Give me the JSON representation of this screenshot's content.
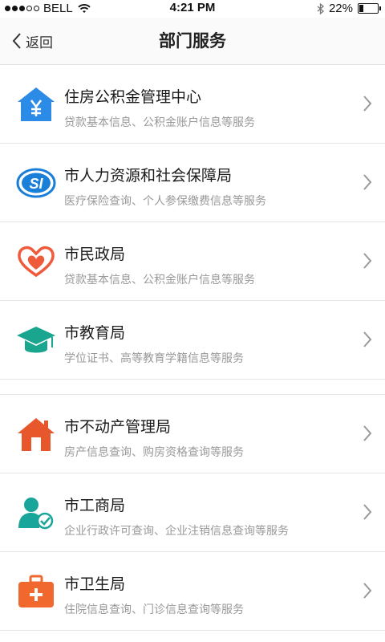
{
  "status": {
    "carrier": "BELL",
    "time": "4:21 PM",
    "battery": "22%",
    "battery_level": 0.22,
    "signal_bars": 3
  },
  "nav": {
    "back_label": "返回",
    "title": "部门服务"
  },
  "services": [
    {
      "name": "住房公积金管理中心",
      "desc": "贷款基本信息、公积金账户信息等服务",
      "icon": "housing-fund-icon",
      "color": "#2b8be6"
    },
    {
      "name": "市人力资源和社会保障局",
      "desc": "医疗保险查询、个人参保缴费信息等服务",
      "icon": "social-security-icon",
      "color": "#1a7fd8"
    },
    {
      "name": "市民政局",
      "desc": "贷款基本信息、公积金账户信息等服务",
      "icon": "heart-hands-icon",
      "color": "#ee5a3a"
    },
    {
      "name": "市教育局",
      "desc": "学位证书、高等教育学籍信息等服务",
      "icon": "graduation-cap-icon",
      "color": "#1aa58f"
    },
    {
      "name": "市不动产管理局",
      "desc": "房产信息查询、购房资格查询等服务",
      "icon": "house-icon",
      "color": "#e8562c"
    },
    {
      "name": "市工商局",
      "desc": "企业行政许可查询、企业注销信息查询等服务",
      "icon": "user-check-icon",
      "color": "#1aa59a"
    },
    {
      "name": "市卫生局",
      "desc": "住院信息查询、门诊信息查询等服务",
      "icon": "medical-kit-icon",
      "color": "#f0682e"
    }
  ]
}
